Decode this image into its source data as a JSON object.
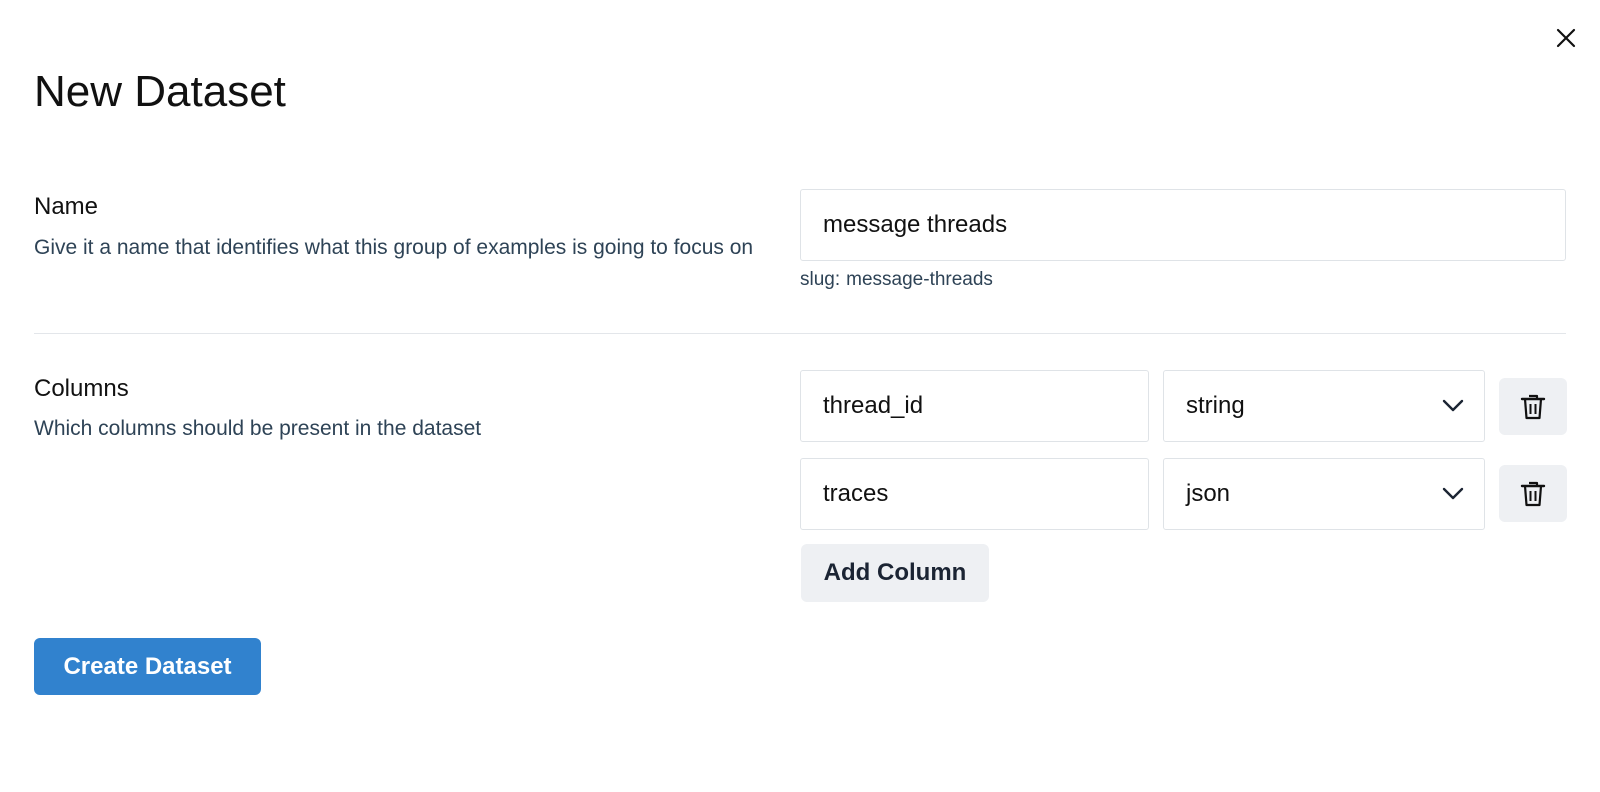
{
  "dialog": {
    "title": "New Dataset",
    "close_icon": "close-icon"
  },
  "name_section": {
    "label": "Name",
    "description": "Give it a name that identifies what this group of examples is going to focus on",
    "input_value": "message threads",
    "slug_prefix": "slug:",
    "slug_value": "message-threads"
  },
  "columns_section": {
    "label": "Columns",
    "description": "Which columns should be present in the dataset",
    "columns": [
      {
        "name": "thread_id",
        "type": "string",
        "delete_icon": "trash-icon"
      },
      {
        "name": "traces",
        "type": "json",
        "delete_icon": "trash-icon"
      }
    ],
    "dropdown_icon": "chevron-down-icon",
    "add_column_label": "Add Column"
  },
  "actions": {
    "create_label": "Create Dataset"
  },
  "colors": {
    "primary": "#3182ce",
    "secondary_button_bg": "#eef0f3",
    "description_text": "#2e4356",
    "border": "#dfe3e7"
  }
}
